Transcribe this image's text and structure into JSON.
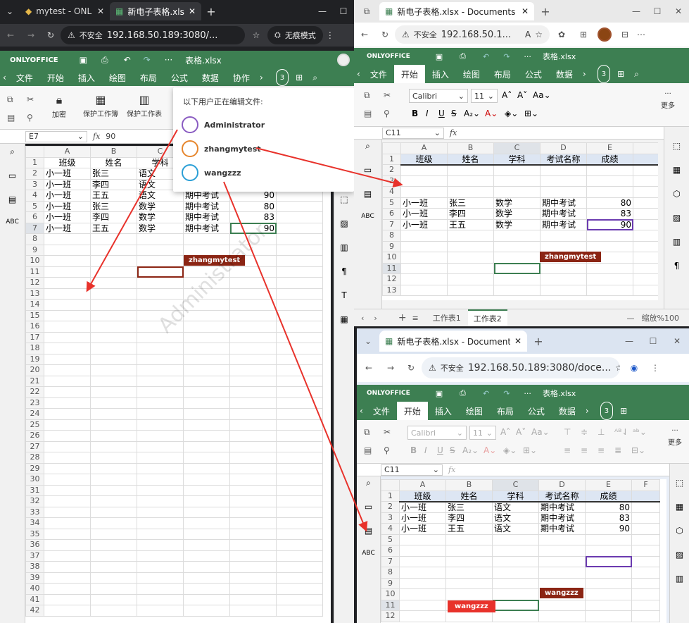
{
  "left": {
    "tabs": [
      {
        "label": "mytest - ONL"
      },
      {
        "label": "新电子表格.xlsx"
      }
    ],
    "address": {
      "security": "不安全",
      "url": "192.168.50.189:3080/...",
      "incognito": "无痕模式"
    },
    "oo": {
      "brand": "ONLYOFFICE",
      "filename": "表格.xlsx",
      "menus": [
        "文件",
        "开始",
        "插入",
        "绘图",
        "布局",
        "公式",
        "数据",
        "协作"
      ],
      "users_count": "3",
      "toolbar": {
        "encrypt": "加密",
        "protect_workbook": "保护工作簿",
        "protect_sheet": "保护工作表"
      },
      "cell_ref": "E7",
      "formula_value": "90"
    },
    "editors_popup": {
      "title": "以下用户正在编辑文件:",
      "users": [
        "Administrator",
        "zhangmytest",
        "wangzzz"
      ]
    },
    "watermark": "Administrator",
    "collab_tag": "zhangmytest",
    "cols": [
      "A",
      "B",
      "C",
      "D",
      "E"
    ],
    "rows": [
      [
        "班级",
        "姓名",
        "学科",
        "",
        ""
      ],
      [
        "小一班",
        "张三",
        "语文",
        "",
        ""
      ],
      [
        "小一班",
        "李四",
        "语文",
        "",
        ""
      ],
      [
        "小一班",
        "王五",
        "语文",
        "期中考试",
        "90"
      ],
      [
        "小一班",
        "张三",
        "数学",
        "期中考试",
        "80"
      ],
      [
        "小一班",
        "李四",
        "数学",
        "期中考试",
        "83"
      ],
      [
        "小一班",
        "王五",
        "数学",
        "期中考试",
        "90"
      ]
    ],
    "row_numbers": [
      "1",
      "2",
      "3",
      "4",
      "5",
      "6",
      "7",
      "8",
      "9",
      "10",
      "11",
      "12",
      "13",
      "14",
      "15",
      "16",
      "17",
      "18",
      "19",
      "20",
      "21",
      "22",
      "23",
      "24",
      "25",
      "26",
      "27",
      "28",
      "29",
      "30",
      "31",
      "32",
      "33",
      "34",
      "35",
      "36",
      "37",
      "38",
      "39",
      "40",
      "41",
      "42"
    ]
  },
  "right_top": {
    "tab_label": "新电子表格.xlsx - Documents",
    "address": {
      "security": "不安全",
      "url": "192.168.50.1...",
      "reader": "A"
    },
    "oo": {
      "brand": "ONLYOFFICE",
      "filename": "表格.xlsx",
      "menus": [
        "文件",
        "开始",
        "插入",
        "绘图",
        "布局",
        "公式",
        "数据"
      ],
      "users_count": "3",
      "font": "Calibri",
      "font_size": "11",
      "more": "更多",
      "cell_ref": "C11"
    },
    "cols": [
      "A",
      "B",
      "C",
      "D",
      "E"
    ],
    "rows": [
      [
        "班级",
        "姓名",
        "学科",
        "考试名称",
        "成绩"
      ],
      [
        "",
        "",
        "",
        "",
        ""
      ],
      [
        "",
        "",
        "",
        "",
        ""
      ],
      [
        "",
        "",
        "",
        "",
        ""
      ],
      [
        "小一班",
        "张三",
        "数学",
        "期中考试",
        "80"
      ],
      [
        "小一班",
        "李四",
        "数学",
        "期中考试",
        "83"
      ],
      [
        "小一班",
        "王五",
        "数学",
        "期中考试",
        "90"
      ],
      [
        "",
        "",
        "",
        "",
        ""
      ],
      [
        "",
        "",
        "",
        "",
        ""
      ],
      [
        "",
        "",
        "",
        "",
        ""
      ],
      [
        "",
        "",
        "",
        "",
        ""
      ],
      [
        "",
        "",
        "",
        "",
        ""
      ],
      [
        "",
        "",
        "",
        "",
        ""
      ]
    ],
    "row_numbers": [
      "1",
      "2",
      "3",
      "4",
      "5",
      "6",
      "7",
      "8",
      "9",
      "10",
      "11",
      "12",
      "13"
    ],
    "collab_tag": "zhangmytest",
    "sheet_tabs": [
      "工作表1",
      "工作表2"
    ],
    "zoom": "缩放%100"
  },
  "right_bottom": {
    "tab_label": "新电子表格.xlsx - Documents",
    "address": {
      "security": "不安全",
      "url": "192.168.50.189:3080/doce..."
    },
    "oo": {
      "brand": "ONLYOFFICE",
      "filename": "表格.xlsx",
      "menus": [
        "文件",
        "开始",
        "插入",
        "绘图",
        "布局",
        "公式",
        "数据"
      ],
      "users_count": "3",
      "font": "Calibri",
      "font_size": "11",
      "more": "更多",
      "cell_ref": "C11"
    },
    "cols": [
      "A",
      "B",
      "C",
      "D",
      "E",
      "F"
    ],
    "rows": [
      [
        "班级",
        "姓名",
        "学科",
        "考试名称",
        "成绩"
      ],
      [
        "小一班",
        "张三",
        "语文",
        "期中考试",
        "80"
      ],
      [
        "小一班",
        "李四",
        "语文",
        "期中考试",
        "83"
      ],
      [
        "小一班",
        "王五",
        "语文",
        "期中考试",
        "90"
      ],
      [
        "",
        "",
        "",
        "",
        ""
      ],
      [
        "",
        "",
        "",
        "",
        ""
      ],
      [
        "",
        "",
        "",
        "",
        ""
      ],
      [
        "",
        "",
        "",
        "",
        ""
      ],
      [
        "",
        "",
        "",
        "",
        ""
      ],
      [
        "",
        "",
        "",
        "",
        ""
      ],
      [
        "",
        "",
        "",
        "",
        ""
      ],
      [
        "",
        "",
        "",
        "",
        ""
      ]
    ],
    "row_numbers": [
      "1",
      "2",
      "3",
      "4",
      "5",
      "6",
      "7",
      "8",
      "9",
      "10",
      "11",
      "12"
    ],
    "collab_tags": [
      "wangzzz",
      "wangzzz"
    ]
  },
  "colors": {
    "oo_green": "#3d7f52",
    "arrow_red": "#e8322b",
    "tag_brown": "#8b2514",
    "tag_red": "#e8322b",
    "select_green": "#3d7f52",
    "select_purple": "#6b3bb0"
  }
}
